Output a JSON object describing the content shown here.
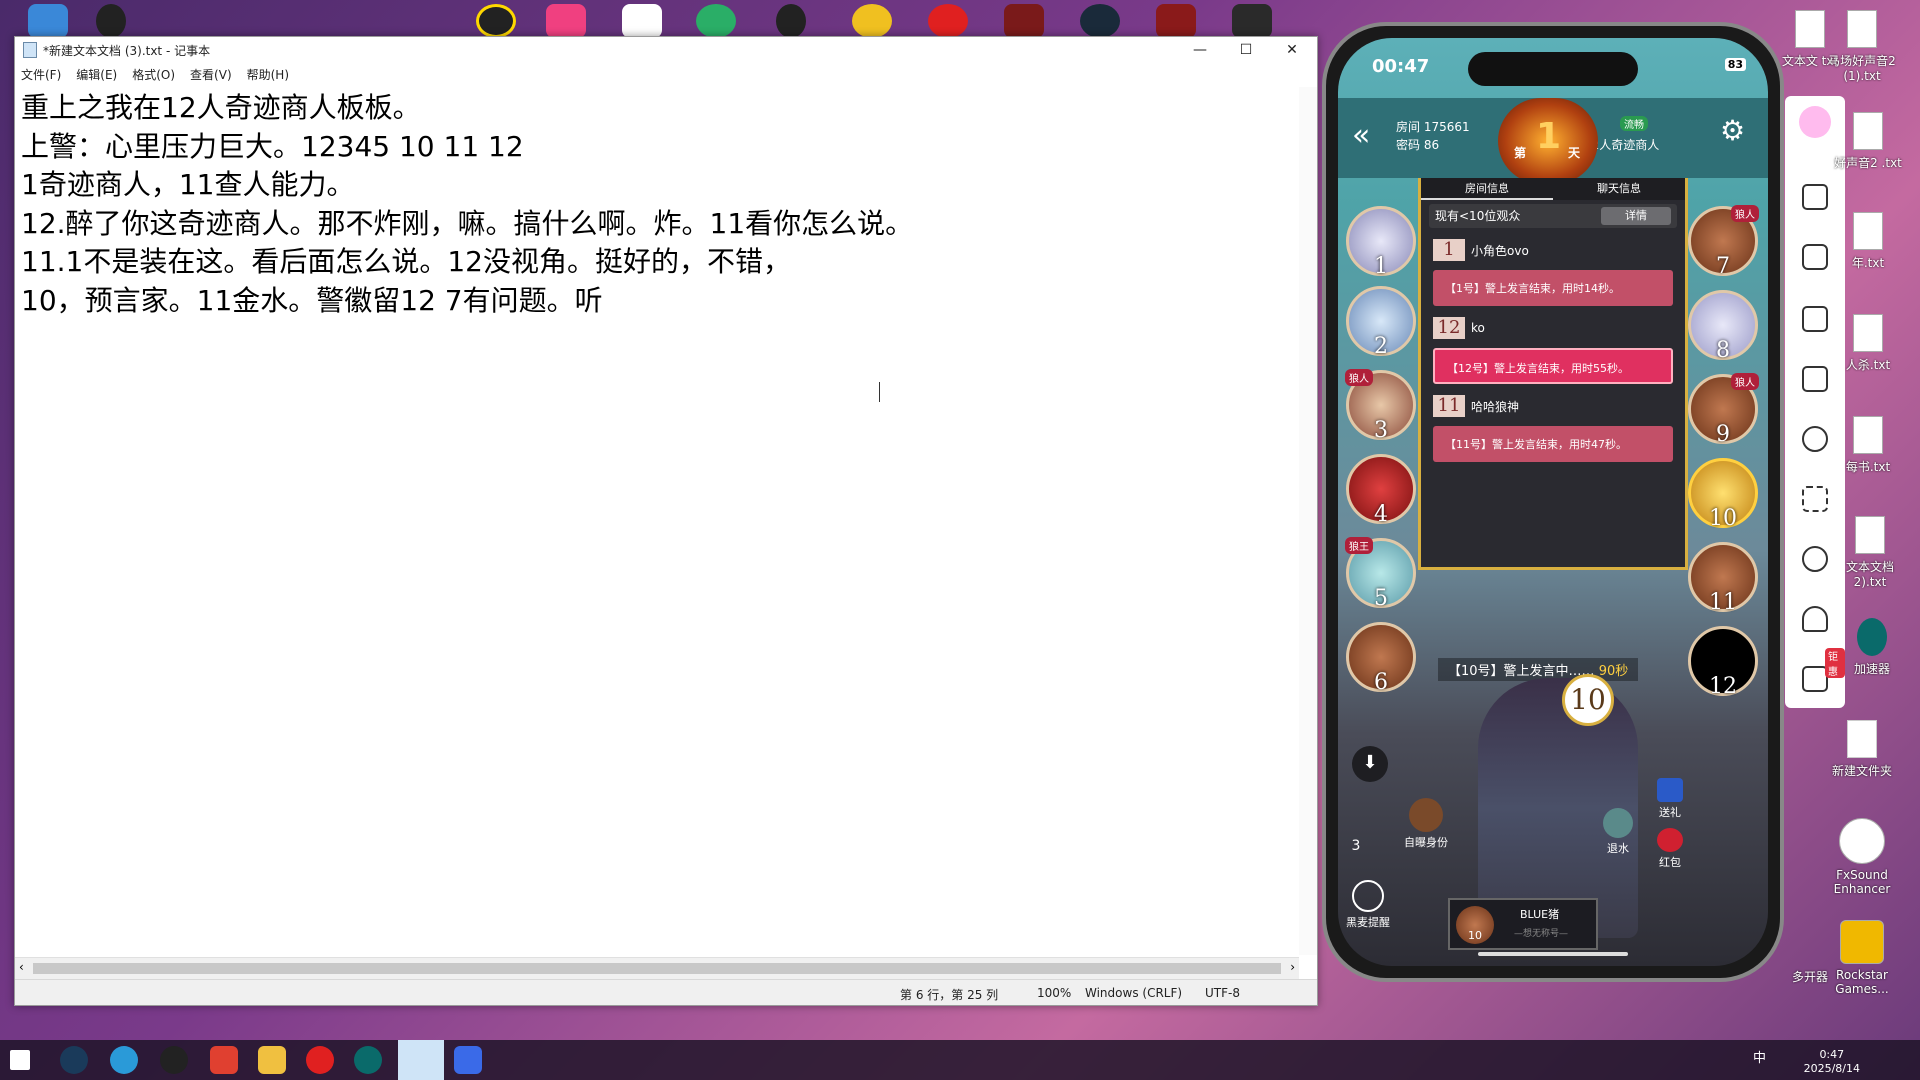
{
  "notepad": {
    "title": "*新建文本文档 (3).txt - 记事本",
    "menu": [
      "文件(F)",
      "编辑(E)",
      "格式(O)",
      "查看(V)",
      "帮助(H)"
    ],
    "lines": [
      "重上之我在12人奇迹商人板板。",
      "上警：心里压力巨大。12345 10 11 12",
      "1奇迹商人，11查人能力。",
      "12.醉了你这奇迹商人。那不炸刚，嘛。搞什么啊。炸。11看你怎么说。",
      "11.1不是装在这。看后面怎么说。12没视角。挺好的，不错，",
      "10，预言家。11金水。警徽留12 7有问题。听"
    ],
    "status": {
      "position": "第 6 行，第 25 列",
      "zoom": "100%",
      "line_ending": "Windows (CRLF)",
      "encoding": "UTF-8"
    }
  },
  "phone": {
    "time": "00:47",
    "battery": "83",
    "room": "房间 175661",
    "password": "密码 86",
    "net": "流畅",
    "mode": "12人奇迹商人",
    "day_label_1": "第",
    "day_num": "1",
    "day_label_2": "天",
    "tabs": [
      "房间信息",
      "聊天信息"
    ],
    "viewers": "现有<10位观众",
    "details": "详情",
    "messages": [
      {
        "num": "1",
        "name": "小角色ovo",
        "text": "【1号】警上发言结束，用时14秒。"
      },
      {
        "num": "12",
        "name": "ko",
        "text": "【12号】警上发言结束，用时55秒。"
      },
      {
        "num": "11",
        "name": "哈哈狼神",
        "text": "【11号】警上发言结束，用时47秒。"
      }
    ],
    "seats_left": [
      "1",
      "2",
      "3",
      "4",
      "5",
      "6"
    ],
    "seats_right": [
      "7",
      "8",
      "9",
      "10",
      "11",
      "12"
    ],
    "tag_wolf": "狼人",
    "tag_king": "狼王",
    "speaking": "【10号】警上发言中……",
    "speaking_sec": "90秒",
    "bubble_num": "10",
    "bottom_user": "BLUE猪",
    "bottom_user_sub": "—想无称号—",
    "bottom_seat": "10",
    "btn_reveal": "自曝身份",
    "btn_count": "3",
    "btn_exit": "退水",
    "btn_gift": "送礼",
    "btn_hongbao": "红包",
    "btn_mic": "黑麦提醒"
  },
  "desktop": {
    "icons": [
      {
        "label": "文本文 txt"
      },
      {
        "label": "马场好声音2 (1).txt"
      },
      {
        "label": "好声音2 .txt"
      },
      {
        "label": "年.txt"
      },
      {
        "label": "人杀.txt"
      },
      {
        "label": "每书.txt"
      },
      {
        "label": "文本文档 2).txt"
      },
      {
        "label": "加速器"
      },
      {
        "label": "新建文件夹"
      },
      {
        "label": "FxSound Enhancer"
      },
      {
        "label": "Rockstar Games..."
      },
      {
        "label": "多开器"
      }
    ],
    "badge": "钜惠"
  },
  "tray": {
    "time": "0:47",
    "date": "2025/8/14",
    "ime": "中"
  }
}
